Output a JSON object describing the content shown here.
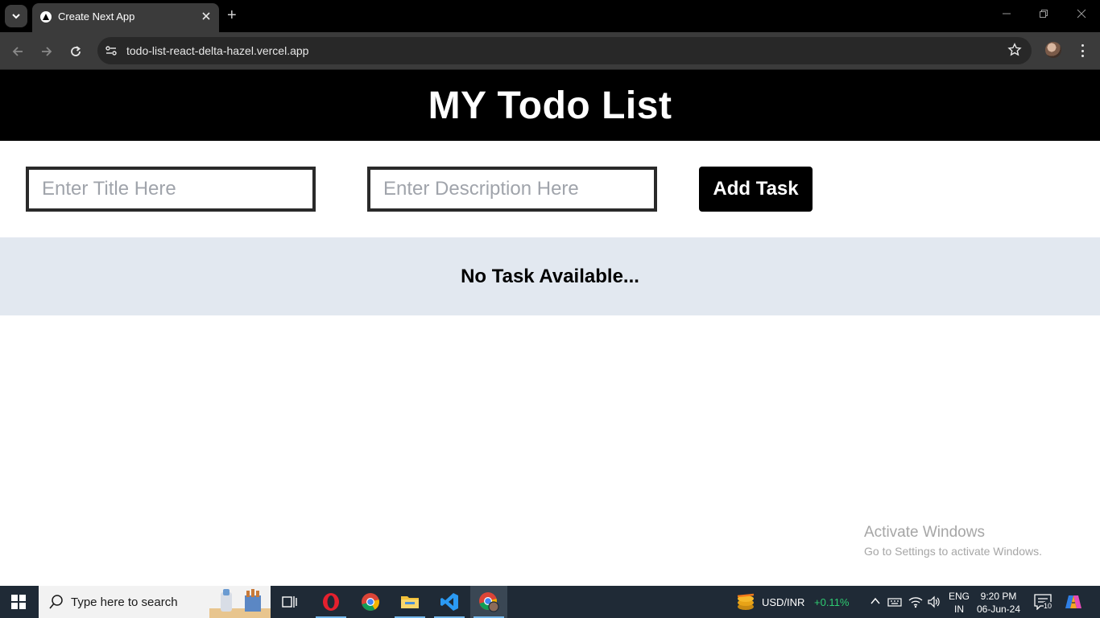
{
  "browser": {
    "tab_title": "Create Next App",
    "url": "todo-list-react-delta-hazel.vercel.app"
  },
  "app": {
    "title": "MY Todo List",
    "title_placeholder": "Enter Title Here",
    "title_value": "",
    "description_placeholder": "Enter Description Here",
    "description_value": "",
    "add_button": "Add Task",
    "empty_message": "No Task Available..."
  },
  "watermark": {
    "title": "Activate Windows",
    "subtitle": "Go to Settings to activate Windows."
  },
  "taskbar": {
    "search_placeholder": "Type here to search",
    "stock_label": "USD/INR",
    "stock_change": "+0.11%",
    "lang_line1": "ENG",
    "lang_line2": "IN",
    "time": "9:20 PM",
    "date": "06-Jun-24",
    "notification_count": "10"
  },
  "colors": {
    "header_bg": "#000000",
    "task_area_bg": "#e2e8f0",
    "stock_positive": "#2ecc71",
    "taskbar_bg": "#1f2a36"
  },
  "icons": [
    "tab-list-icon",
    "nextjs-favicon-icon",
    "close-icon",
    "plus-icon",
    "back-icon",
    "forward-icon",
    "reload-icon",
    "site-info-icon",
    "star-icon",
    "profile-avatar",
    "menu-icon",
    "windows-start-icon",
    "search-icon",
    "task-view-icon",
    "opera-icon",
    "chrome-icon",
    "file-explorer-icon",
    "vscode-icon",
    "chrome-profile-icon",
    "stock-icon",
    "chevron-up-icon",
    "keyboard-icon",
    "wifi-icon",
    "volume-icon",
    "notification-icon",
    "copilot-icon"
  ]
}
